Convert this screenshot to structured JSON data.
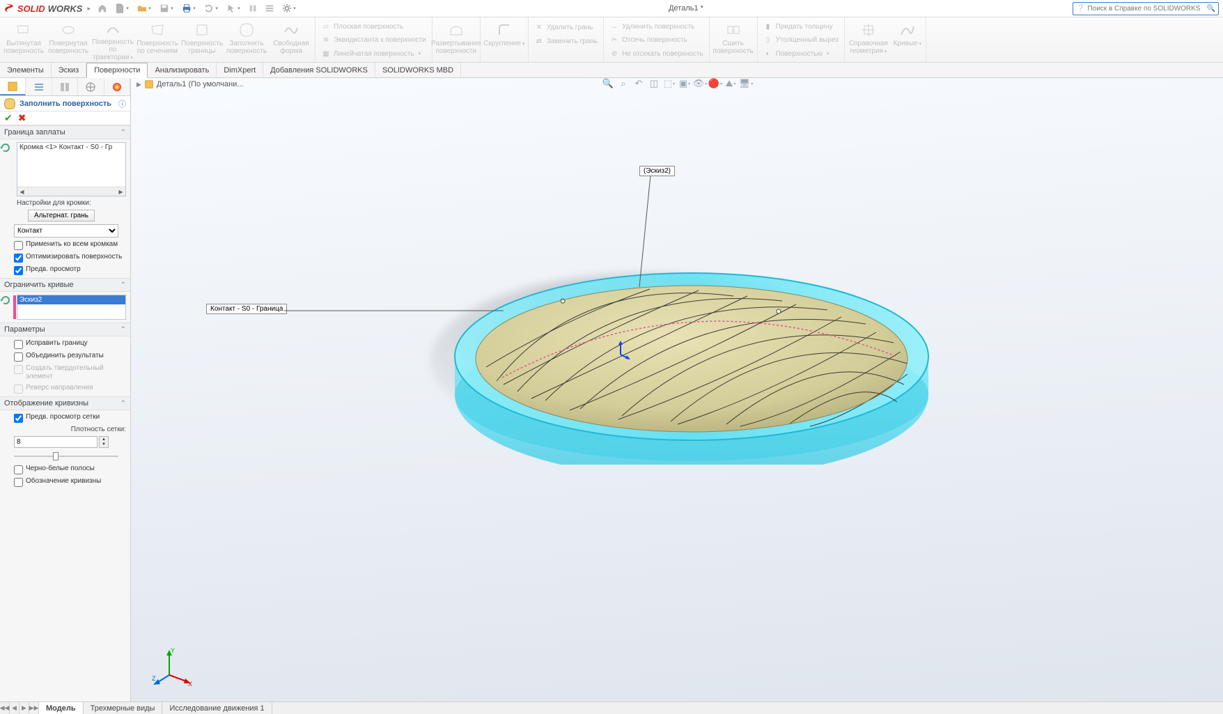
{
  "app": {
    "brand_solid": "SOLID",
    "brand_works": "WORKS",
    "title": "Деталь1 *",
    "search_placeholder": "Поиск в Справке по SOLIDWORKS"
  },
  "ribbon": {
    "extrude": "Вытянутая поверхность",
    "revolve": "Повернутая поверхность",
    "swept": "Поверхность по траектории",
    "loft": "Поверхность по сечениям",
    "boundary": "Поверхность границы",
    "fill": "Заполнить поверхность",
    "freeform": "Свободная форма",
    "planar": "Плоская поверхность",
    "offset": "Эквидистанта к поверхности",
    "ruled": "Линейчатая поверхность",
    "flatten": "Развертывание поверхности",
    "fillet": "Скругление",
    "deleteface": "Удалить грань",
    "replaceface": "Заменить грань",
    "extend": "Удлинить поверхность",
    "trim": "Отсечь поверхность",
    "untrim": "Не отсекать поверхность",
    "knit": "Сшить поверхность",
    "thicken": "Придать толщину",
    "thickcut": "Утолщенный вырез",
    "cutwith": "Поверхностью",
    "refgeom": "Справочная геометрия",
    "curves": "Кривые"
  },
  "tabs": {
    "features": "Элементы",
    "sketch": "Эскиз",
    "surfaces": "Поверхности",
    "evaluate": "Анализировать",
    "dimxpert": "DimXpert",
    "addins": "Добавления SOLIDWORKS",
    "mbd": "SOLIDWORKS MBD"
  },
  "breadcrumb": {
    "part": "Деталь1  (По умолчани..."
  },
  "panel": {
    "title": "Заполнить поверхность",
    "sections": {
      "patch_boundary": "Граница заплаты",
      "constraint_curves": "Ограничить кривые",
      "options": "Параметры",
      "curvature_display": "Отображение кривизны"
    },
    "boundary_item": "Кромка <1> Контакт - S0 - Гр",
    "edge_settings_label": "Настройки для кромки:",
    "alt_face_btn": "Альтернат. грань",
    "contact_dd": "Контакт",
    "apply_all": "Применить ко всем кромкам",
    "optimize": "Оптимизировать поверхность",
    "preview": "Предв. просмотр",
    "constraint_item": "Эскиз2",
    "fix_boundary": "Исправить границу",
    "merge": "Объединить результаты",
    "create_solid": "Создать твердотельный элемент",
    "reverse_dir": "Реверс направления",
    "mesh_preview": "Предв. просмотр сетки",
    "mesh_density_label": "Плотность сетки:",
    "mesh_density_value": "8",
    "zebra": "Черно-белые полосы",
    "curvature_label": "Обозначение кривизны"
  },
  "callouts": {
    "sketch": "(Эскиз2)",
    "boundary": "Контакт - S0 - Граница"
  },
  "bottom_tabs": {
    "model": "Модель",
    "views3d": "Трехмерные виды",
    "motion": "Исследование движения 1"
  }
}
